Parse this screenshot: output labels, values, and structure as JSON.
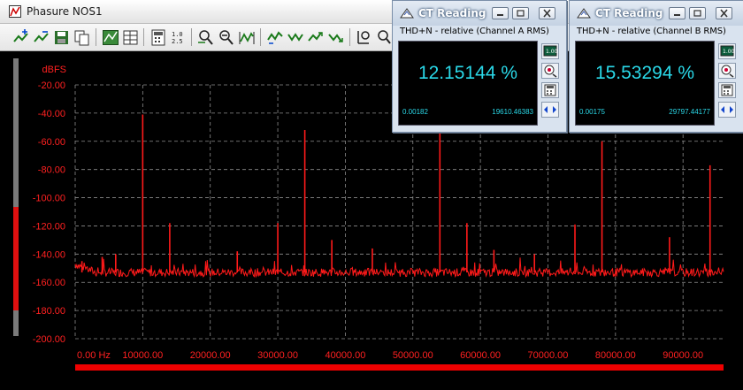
{
  "window": {
    "title": "Phasure NOS1"
  },
  "toolbar": {
    "icons": [
      "add-trace-icon",
      "remove-trace-icon",
      "save-icon",
      "copy-icon",
      "graph-icon",
      "table-icon",
      "calculator-icon",
      "number-grid-icon",
      "zoom-in-icon",
      "zoom-out-icon",
      "waveform-icon",
      "markers-icon",
      "arrows-icon",
      "peak-icon",
      "peak-down-icon",
      "cursor-icon",
      "cursor-zoom-icon"
    ]
  },
  "ct_readings": [
    {
      "title": "CT Reading",
      "label": "THD+N - relative (Channel A RMS)",
      "value": "12.15144 %",
      "min": "0.00182",
      "max": "19610.46383"
    },
    {
      "title": "CT Reading",
      "label": "THD+N - relative (Channel B RMS)",
      "value": "15.53294 %",
      "min": "0.00175",
      "max": "29797.44177"
    }
  ],
  "colors": {
    "trace": "#ff1a1a",
    "axis_text": "#ff2020",
    "grid": "#8c8c8c",
    "readout": "#2ad8e8",
    "background": "#000000"
  },
  "chart_data": {
    "type": "line",
    "ylabel": "dBFS",
    "xlabel": "",
    "ylim": [
      -200,
      -20
    ],
    "xlim": [
      0,
      96000
    ],
    "grid": true,
    "yticks": [
      "-20.00",
      "-40.00",
      "-60.00",
      "-80.00",
      "-100.00",
      "-120.00",
      "-140.00",
      "-160.00",
      "-180.00",
      "-200.00"
    ],
    "ytick_values": [
      -20,
      -40,
      -60,
      -80,
      -100,
      -120,
      -140,
      -160,
      -180,
      -200
    ],
    "xticks": [
      "0.00 Hz",
      "10000.00",
      "20000.00",
      "30000.00",
      "40000.00",
      "50000.00",
      "60000.00",
      "70000.00",
      "80000.00",
      "90000.00"
    ],
    "xtick_values": [
      0,
      10000,
      20000,
      30000,
      40000,
      50000,
      60000,
      70000,
      80000,
      90000
    ],
    "noise_floor": -153,
    "peaks": [
      {
        "x": 1000,
        "y": -145
      },
      {
        "x": 4000,
        "y": -142
      },
      {
        "x": 6000,
        "y": -140
      },
      {
        "x": 10000,
        "y": -41
      },
      {
        "x": 14000,
        "y": -118
      },
      {
        "x": 24000,
        "y": -138
      },
      {
        "x": 30000,
        "y": -118
      },
      {
        "x": 34000,
        "y": -52
      },
      {
        "x": 38000,
        "y": -130
      },
      {
        "x": 44000,
        "y": -136
      },
      {
        "x": 54000,
        "y": -51
      },
      {
        "x": 58000,
        "y": -118
      },
      {
        "x": 62000,
        "y": -137
      },
      {
        "x": 68000,
        "y": -140
      },
      {
        "x": 74000,
        "y": -119
      },
      {
        "x": 78000,
        "y": -60
      },
      {
        "x": 88000,
        "y": -128
      },
      {
        "x": 94000,
        "y": -77
      }
    ]
  }
}
